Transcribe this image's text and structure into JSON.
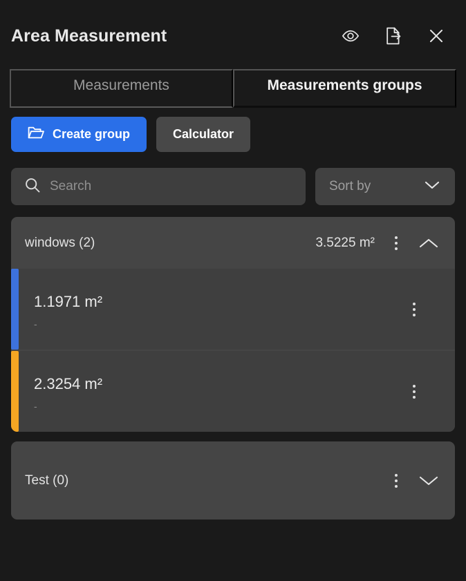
{
  "header": {
    "title": "Area Measurement",
    "actions": [
      {
        "icon": "eye-icon",
        "label": "Toggle visibility"
      },
      {
        "icon": "file-export-icon",
        "label": "Export"
      },
      {
        "icon": "close-icon",
        "label": "Close"
      }
    ]
  },
  "tabs": [
    {
      "label": "Measurements",
      "active": false
    },
    {
      "label": "Measurements groups",
      "active": true
    }
  ],
  "toolbar": {
    "create_group_label": "Create group",
    "create_group_icon": "folder-icon",
    "calculator_label": "Calculator",
    "primary_color": "#2a6fe8",
    "secondary_color": "#484848"
  },
  "search": {
    "placeholder": "Search",
    "value": "",
    "icon": "search-icon"
  },
  "sort": {
    "label": "Sort by",
    "icon": "chevron-down-icon"
  },
  "groups": [
    {
      "name": "windows (2)",
      "area": "3.5225 m²",
      "expanded": true,
      "chevron": "chevron-up-icon",
      "measurements": [
        {
          "value": "1.1971 m²",
          "subtitle": "-",
          "color": "#3d72dd"
        },
        {
          "value": "2.3254 m²",
          "subtitle": "-",
          "color": "#f5a623"
        }
      ]
    },
    {
      "name": "Test (0)",
      "area": "",
      "expanded": false,
      "chevron": "chevron-down-icon",
      "measurements": []
    }
  ]
}
